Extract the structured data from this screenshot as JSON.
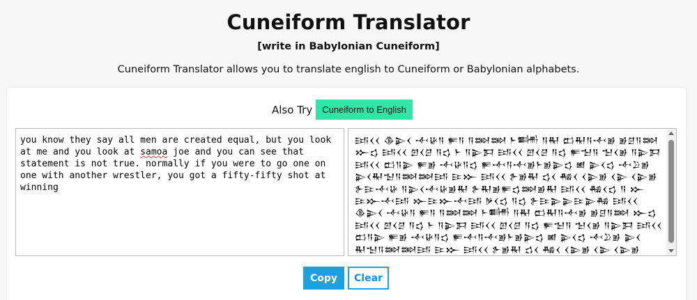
{
  "header": {
    "title": "Cuneiform Translator",
    "subtitle": "[write in Babylonian Cuneiform]",
    "description": "Cuneiform Translator allows you to translate english to Cuneiform or Babylonian alphabets."
  },
  "also_try": {
    "label": "Also Try",
    "button_label": "Cuneiform to English",
    "button_color": "#2ee6a6"
  },
  "input": {
    "text_before": "you know they say all men are created equal, but you look at me and you look at ",
    "text_misspelled": "samoa",
    "text_after": " joe and you can see that statement is not true. normally if you were to go one on one with another wrestler, you got a fifty-fifty shot at winning"
  },
  "output": {
    "cuneiform_text": "𒅀𒌋𒌋 𒆠𒉌𒌋 𒋾𒄩𒀀 𒊓𒀀 𒀀𒇷𒇷 𒈨𒌦 𒀀𒊑 𒆗𒊑𒀀𒋾𒂊 𒂊𒆪𒀀𒇷 𒁍𒌓 𒅀𒌋𒌋 𒇻𒌋𒆪 𒀀𒌓 𒈨 𒀀𒉌𒁕 𒅀𒌋𒌋 𒇻𒌋𒆪 𒀀𒌓 𒊓𒈠𒀀 𒈠𒌋𒂊 𒀀𒉌𒁕 𒅀𒌋𒌋 𒆗𒀀𒉌 𒊓𒂊 𒋾𒄩𒀀𒌓 𒊓𒋾𒀀𒋾𒂊𒈨𒂊𒉌𒌓 𒅖 𒉌𒌋𒌓 𒋾𒊒𒂊 𒉌𒌋𒊑𒈠𒀀𒇷𒇷𒅀 𒄿𒁍 𒅀𒌋𒌋 𒉿𒂊𒊑 𒌓𒌋 𒄀𒌋 𒌋𒉌𒂊 𒌋𒉌 𒌋𒉌𒂊 𒉿𒄿𒋾𒄩 𒀀𒉌𒌋𒋾𒄩𒂊𒊑 𒉿𒊑𒂊𒊓𒌓𒇷𒂊𒊑 𒅀𒌋𒌋 𒄀𒌋𒌓 𒀀 𒁍𒄿𒁍𒋾𒅀 𒁍𒄿𒁍𒋾𒅀 𒃻𒌋𒌓 𒀀𒌓 𒉿𒄿𒉌𒉌𒄿𒉌𒄀 𒅀𒌋𒌋 𒆠𒉌𒌋 𒋾𒄩𒀀 𒊓𒀀 𒀀𒇷𒇷 𒈨𒌦 𒀀𒊑 𒆗𒊑𒀀𒋾𒂊 𒂊𒆪𒀀𒇷 𒁍𒌓 𒅀𒌋𒌋 𒇻𒌋𒆪 𒀀𒌓 𒈨 𒀀𒉌𒁕 𒅀𒌋𒌋 𒇻𒌋𒆪 𒀀𒌓 𒊓𒈠𒀀 𒈠𒌋𒂊 𒀀𒉌𒁕 𒅀𒌋𒌋 𒆗𒀀𒉌 𒊓𒂊 𒋾𒄩𒀀𒌓 𒊓𒋾𒀀𒋾𒂊𒈨𒂊𒉌𒌓 𒅖 𒉌𒌋𒌓 𒋾𒊒𒂊 𒉌𒌋𒊑𒈠𒀀𒇷𒇷𒅀 𒄿𒁍 𒅀𒌋𒌋 𒉿𒂊𒊑 𒌓𒌋 𒄀𒌋 𒌋𒉌𒂊 𒌋𒉌 𒌋𒉌𒂊 𒉿𒄿𒋾𒄩 𒀀𒉌𒌋𒋾𒄩𒂊𒊑 𒉿𒊑𒂊𒊓𒌓𒇷𒂊𒊑 𒅀𒌋𒌋 𒄀𒌋𒌓 𒀀 𒁍𒄿𒁍𒋾𒅀 𒁍𒄿𒁍𒋾𒅀 𒃻𒌋𒌓 𒀀𒌓 𒉿𒄿𒉌𒉌𒄿𒉌𒄀"
  },
  "buttons": {
    "copy_label": "Copy",
    "clear_label": "Clear",
    "accent_color": "#1ba0e0"
  }
}
